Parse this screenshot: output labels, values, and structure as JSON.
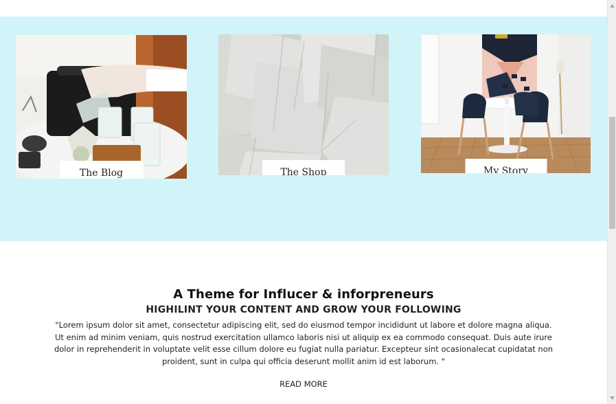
{
  "cards": [
    {
      "label": "The Blog",
      "image": "pouring-water-table-photo"
    },
    {
      "label": "The Shop",
      "image": "paper-sheets-photo"
    },
    {
      "label": "My Story",
      "image": "dining-room-photo"
    }
  ],
  "intro": {
    "title": "A Theme for Influcer & inforpreneurs",
    "subtitle": "HIGHILINT YOUR CONTENT AND GROW YOUR FOLLOWING",
    "body": "\"Lorem ipsum dolor sit amet, consectetur adipiscing elit, sed do eiusmod tempor incididunt ut labore et dolore magna aliqua. Ut enim ad minim veniam, quis nostrud exercitation ullamco laboris nisi ut aliquip ex ea commodo consequat. Duis aute irure dolor in reprehenderit in voluptate velit esse cillum dolore eu fugiat nulla pariatur. Excepteur sint ocasionalecat cupidatat non proident, sunt in culpa qui officia deserunt mollit anim id est laborum. \"",
    "read_more": "READ MORE"
  },
  "colors": {
    "band_background": "#d1f4f8",
    "page_background": "#ffffff",
    "text": "#222222"
  }
}
